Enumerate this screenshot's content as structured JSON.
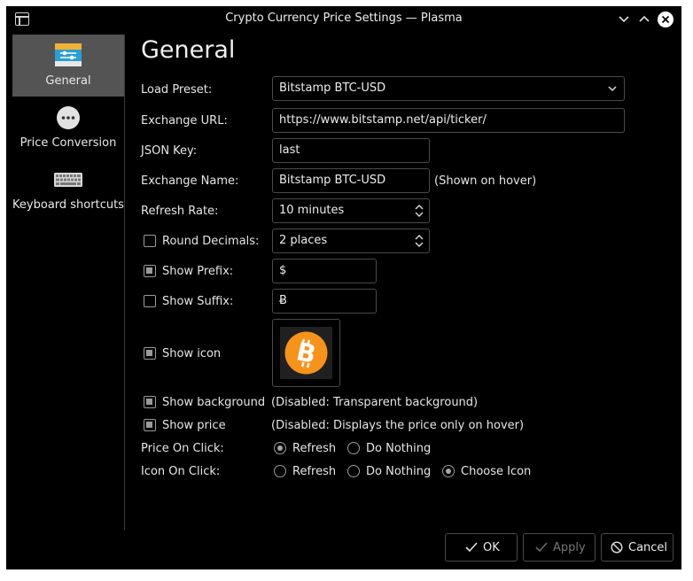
{
  "window": {
    "title": "Crypto Currency Price Settings — Plasma"
  },
  "sidebar": {
    "items": [
      {
        "label": "General",
        "icon": "general-settings-icon",
        "active": true
      },
      {
        "label": "Price Conversion",
        "icon": "more-options-icon",
        "active": false
      },
      {
        "label": "Keyboard shortcuts",
        "icon": "keyboard-icon",
        "active": false
      }
    ]
  },
  "page": {
    "title": "General"
  },
  "form": {
    "load_preset": {
      "label": "Load Preset:",
      "value": "Bitstamp BTC-USD"
    },
    "exchange_url": {
      "label": "Exchange URL:",
      "value": "https://www.bitstamp.net/api/ticker/"
    },
    "json_key": {
      "label": "JSON Key:",
      "value": "last"
    },
    "exchange_name": {
      "label": "Exchange Name:",
      "value": "Bitstamp BTC-USD",
      "note": "(Shown on hover)"
    },
    "refresh_rate": {
      "label": "Refresh Rate:",
      "value": "10 minutes"
    },
    "round_decimals": {
      "label": "Round Decimals:",
      "value": "2 places",
      "checked": false
    },
    "show_prefix": {
      "label": "Show Prefix:",
      "value": "$",
      "checked": true
    },
    "show_suffix": {
      "label": "Show Suffix:",
      "value": "Ƀ",
      "checked": false
    },
    "show_icon": {
      "label": "Show icon",
      "checked": true,
      "icon": "bitcoin-icon",
      "icon_color": "#f7931a"
    },
    "show_background": {
      "label": "Show background",
      "checked": true,
      "note": "(Disabled: Transparent background)"
    },
    "show_price": {
      "label": "Show price",
      "checked": true,
      "note": "(Disabled: Displays the price only on hover)"
    },
    "price_on_click": {
      "label": "Price On Click:",
      "options": [
        "Refresh",
        "Do Nothing"
      ],
      "selected": "Refresh"
    },
    "icon_on_click": {
      "label": "Icon On Click:",
      "options": [
        "Refresh",
        "Do Nothing",
        "Choose Icon"
      ],
      "selected": "Choose Icon"
    }
  },
  "buttons": {
    "ok": "OK",
    "apply": "Apply",
    "cancel": "Cancel"
  }
}
